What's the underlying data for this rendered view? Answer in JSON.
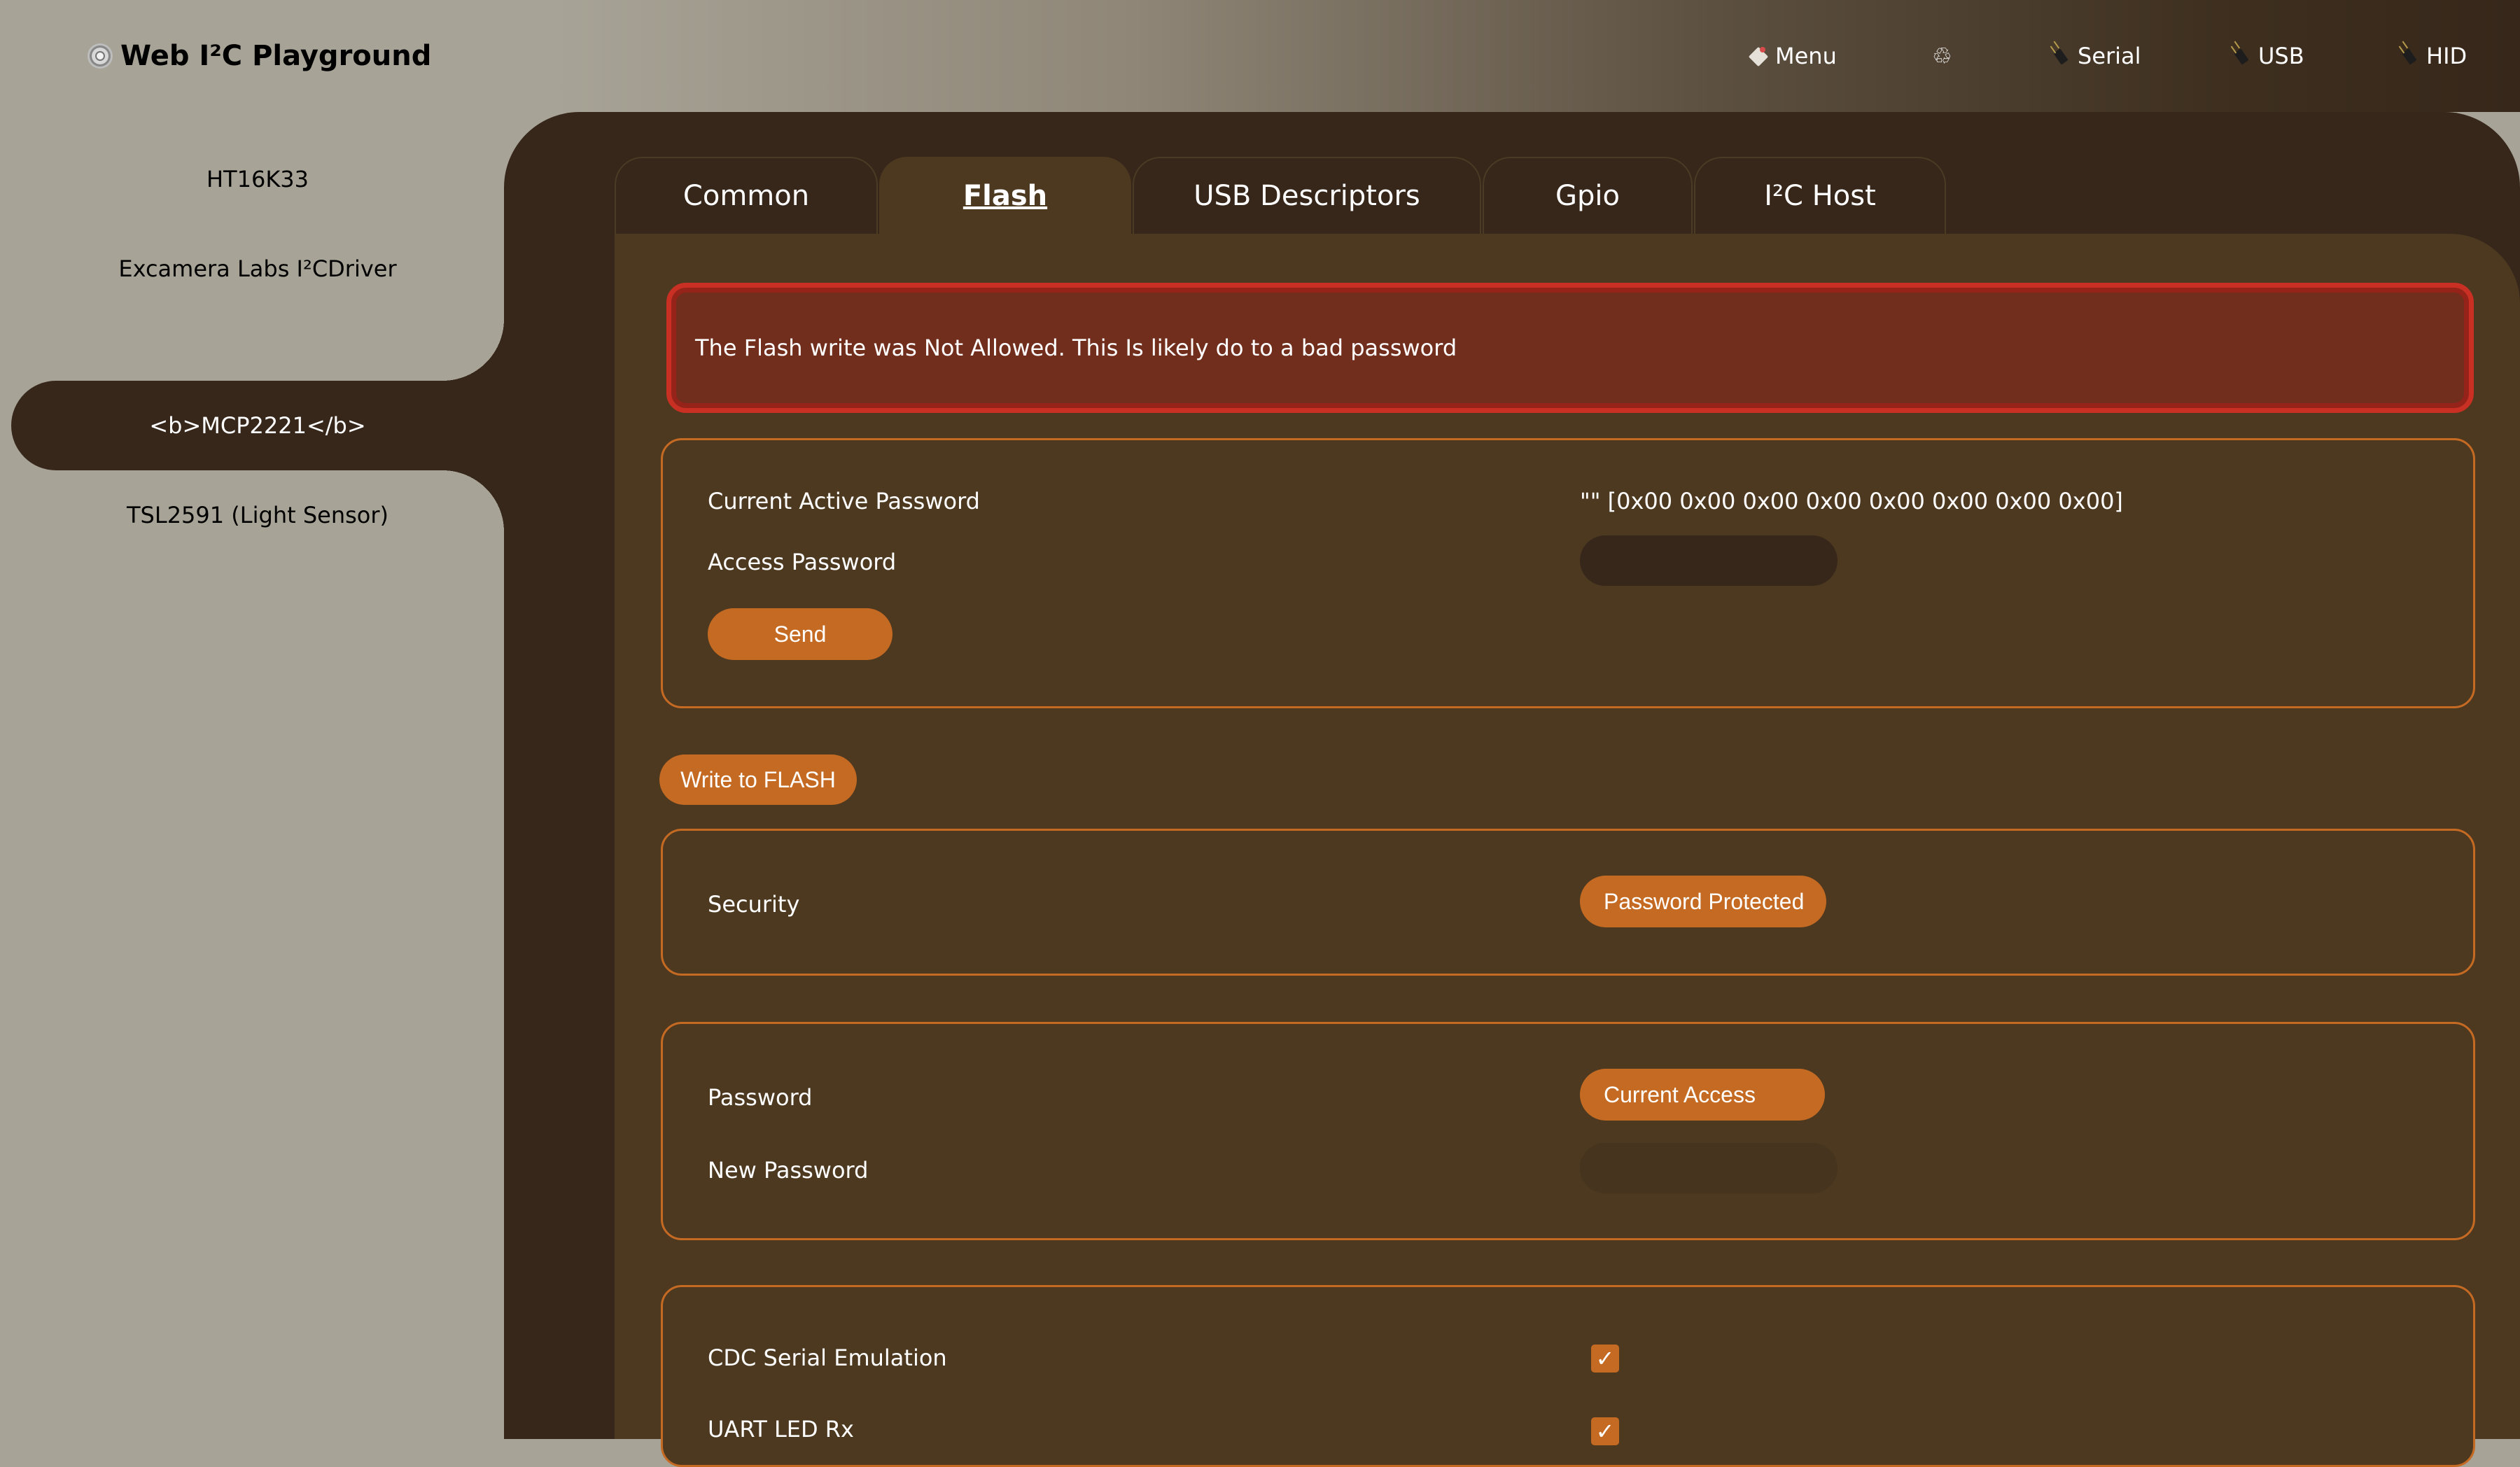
{
  "header": {
    "title": "Web I²C Playground",
    "nav": [
      {
        "label": "Menu",
        "icon": "menu-icon"
      },
      {
        "label": "",
        "icon": "recycle-icon"
      },
      {
        "label": "Serial",
        "icon": "plug-icon"
      },
      {
        "label": "USB",
        "icon": "plug-icon"
      },
      {
        "label": "HID",
        "icon": "plug-icon"
      }
    ]
  },
  "sidebar": {
    "items": [
      {
        "label": "HT16K33",
        "active": false
      },
      {
        "label": "Excamera Labs I²CDriver",
        "active": false
      },
      {
        "label": "<b>MCP2221</b>",
        "active": true
      },
      {
        "label": "TSL2591 (Light Sensor)",
        "active": false
      }
    ]
  },
  "tabs": [
    {
      "label": "Common",
      "active": false
    },
    {
      "label": "Flash",
      "active": true
    },
    {
      "label": "USB Descriptors",
      "active": false
    },
    {
      "label": "Gpio",
      "active": false
    },
    {
      "label": "I²C Host",
      "active": false
    }
  ],
  "alert": {
    "message": "The Flash write was Not Allowed. This Is likely do to a bad password"
  },
  "access_card": {
    "current_label": "Current Active Password",
    "current_value": "\"\" [0x00 0x00 0x00 0x00 0x00 0x00 0x00 0x00]",
    "access_label": "Access Password",
    "access_value": "",
    "send_label": "Send"
  },
  "write_flash_label": "Write to FLASH",
  "security_card": {
    "label": "Security",
    "value": "Password Protected"
  },
  "password_card": {
    "password_label": "Password",
    "password_value": "Current Access",
    "new_password_label": "New Password",
    "new_password_value": ""
  },
  "options_card": {
    "items": [
      {
        "label": "CDC Serial Emulation",
        "checked": true
      },
      {
        "label": "UART LED Rx",
        "checked": true
      }
    ]
  },
  "colors": {
    "accent": "#c56a22",
    "panel": "#36271a",
    "content": "#4d3920",
    "alert_bg": "#712e1d",
    "alert_border": "#c93023",
    "sidebar_bg": "#a7a396"
  }
}
